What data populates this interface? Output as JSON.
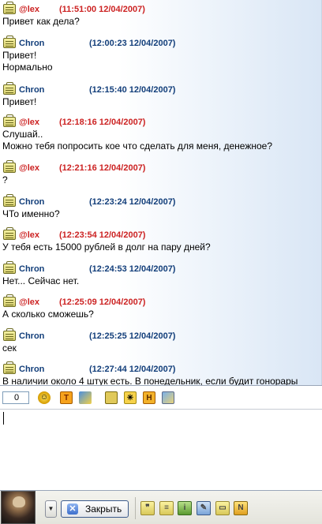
{
  "messages": [
    {
      "user": "@lex",
      "kind": "lex",
      "time": "(11:51:00 12/04/2007)",
      "lines": [
        "Привет как дела?"
      ]
    },
    {
      "user": "Chron",
      "kind": "chron",
      "time": "(12:00:23 12/04/2007)",
      "lines": [
        "Привет!",
        "Нормально"
      ]
    },
    {
      "user": "Chron",
      "kind": "chron",
      "time": "(12:15:40 12/04/2007)",
      "lines": [
        "Привет!"
      ]
    },
    {
      "user": "@lex",
      "kind": "lex",
      "time": "(12:18:16 12/04/2007)",
      "lines": [
        "Слушай..",
        "Можно тебя попросить кое что сделать для меня, денежное?"
      ]
    },
    {
      "user": "@lex",
      "kind": "lex",
      "time": "(12:21:16 12/04/2007)",
      "lines": [
        "?"
      ]
    },
    {
      "user": "Chron",
      "kind": "chron",
      "time": "(12:23:24 12/04/2007)",
      "lines": [
        "ЧТо именно?"
      ]
    },
    {
      "user": "@lex",
      "kind": "lex",
      "time": "(12:23:54 12/04/2007)",
      "lines": [
        "У тебя есть 15000 рублей в долг на пару дней?"
      ]
    },
    {
      "user": "Chron",
      "kind": "chron",
      "time": "(12:24:53 12/04/2007)",
      "lines": [
        "Нет... Сейчас нет."
      ]
    },
    {
      "user": "@lex",
      "kind": "lex",
      "time": "(12:25:09 12/04/2007)",
      "lines": [
        "А сколько сможешь?"
      ]
    },
    {
      "user": "Chron",
      "kind": "chron",
      "time": "(12:25:25 12/04/2007)",
      "lines": [
        "сек"
      ]
    },
    {
      "user": "Chron",
      "kind": "chron",
      "time": "(12:27:44 12/04/2007)",
      "lines": [
        "В наличии около 4 штук есть. В понедельник, если будит гонорары"
      ]
    }
  ],
  "toolbar": {
    "font_size": "0",
    "icons": [
      "smiley-icon",
      "text-format-icon",
      "color-icon",
      "save-icon",
      "emoticons-icon",
      "history-icon",
      "send-file-icon"
    ]
  },
  "input": {
    "value": ""
  },
  "bottom": {
    "close_label": "Закрыть",
    "icons": [
      "quote-icon",
      "message-icon",
      "info-icon",
      "settings-icon",
      "folder-icon",
      "notify-icon"
    ]
  },
  "colors": {
    "lex": "#cc2222",
    "chron": "#123e7a"
  }
}
